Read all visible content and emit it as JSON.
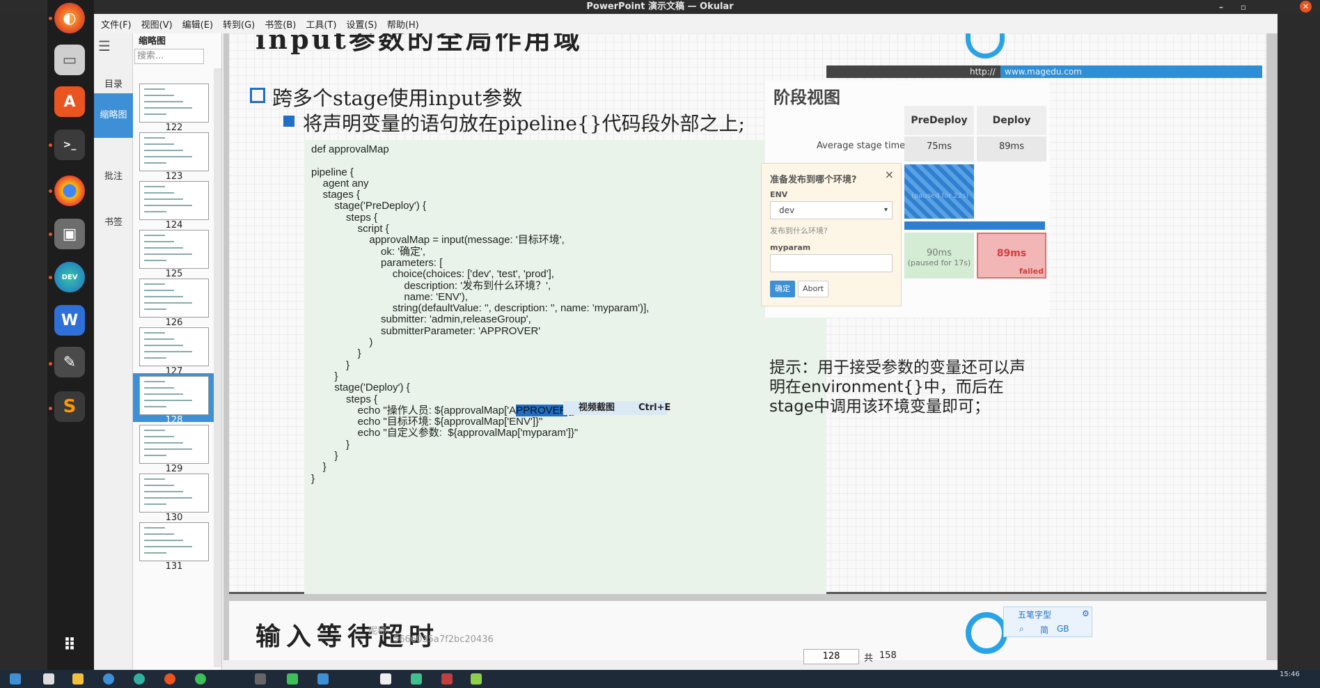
{
  "window": {
    "title": "PowerPoint 演示文稿 — Okular",
    "minimize": "–",
    "maximize": "▫",
    "close": "✕"
  },
  "menu": [
    "文件(F)",
    "视图(V)",
    "编辑(E)",
    "转到(G)",
    "书签(B)",
    "工具(T)",
    "设置(S)",
    "帮助(H)"
  ],
  "sidebar_tabs": {
    "contents": "目录",
    "thumbnails": "缩略图",
    "annotations": "批注",
    "bookmarks": "书签"
  },
  "thumb_panel": {
    "title": "缩略图",
    "search_placeholder": "搜索...",
    "pages": [
      "122",
      "123",
      "124",
      "125",
      "126",
      "127",
      "128",
      "129",
      "130",
      "131"
    ],
    "active_page": "128"
  },
  "slide": {
    "heading_partial": "input参数的全局作用域",
    "logo_url": "http://",
    "logo_domain": "www.magedu.com",
    "bullet1": "跨多个stage使用input参数",
    "bullet2": "将声明变量的语句放在pipeline{}代码段外部之上;",
    "code_lines": [
      "def approvalMap",
      "",
      "pipeline {",
      "    agent any",
      "    stages {",
      "        stage('PreDeploy') {",
      "            steps {",
      "                script {",
      "                    approvalMap = input(message: '目标环境',",
      "                        ok: '确定',",
      "                        parameters: [",
      "                            choice(choices: ['dev', 'test', 'prod'],",
      "                                description: '发布到什么环境？',",
      "                                name: 'ENV'),",
      "                            string(defaultValue: '', description: '', name: 'myparam')],",
      "                        submitter: 'admin,releaseGroup',",
      "                        submitterParameter: 'APPROVER'",
      "                    )",
      "                }",
      "            }",
      "        }",
      "        stage('Deploy') {",
      "            steps {"
    ],
    "echo1_pre": "                echo \"操作人员: ${approvalMap['A",
    "echo1_hl": "PPROVER",
    "echo1_post": "']}\"",
    "code_tail": [
      "                echo \"目标环境: ${approvalMap['ENV']}\"",
      "                echo \"自定义参数:  ${approvalMap['myparam']}\"",
      "            }",
      "        }",
      "    }",
      "}"
    ],
    "tooltip": {
      "label": "视频截图",
      "shortcut": "Ctrl+E"
    },
    "stage_view": {
      "title": "阶段视图",
      "col1": "PreDeploy",
      "col2": "Deploy",
      "avg_label": "Average stage times:",
      "avg1": "75ms",
      "avg2": "89ms",
      "paused1": "(paused for 22s)",
      "row2_val1": "90ms",
      "row2_paused": "(paused for 17s)",
      "row2_val2": "89ms",
      "failed": "failed"
    },
    "dialog": {
      "title": "准备发布到哪个环境?",
      "close": "×",
      "env_label": "ENV",
      "env_value": "dev",
      "env_desc": "发布到什么环境?",
      "param_label": "myparam",
      "ok": "确定",
      "abort": "Abort"
    },
    "hint": "提示：用于接受参数的变量还可以声明在environment{}中，而后在stage中调用该环境变量即可；"
  },
  "slide_next": {
    "title": "输入等待超时",
    "watermark1": "昵称:",
    "watermark2": "5666035a7f2bc20436"
  },
  "ime": {
    "name": "五笔字型",
    "simp": "简",
    "gb": "GB"
  },
  "pager": {
    "current": "128",
    "of_label": "共",
    "total": "158"
  },
  "clock": "15:46",
  "colors": {
    "accent": "#3d8fd6",
    "ubuntu_orange": "#e95420",
    "code_bg": "#e9f3ea",
    "failed_red": "#e26b6b"
  }
}
